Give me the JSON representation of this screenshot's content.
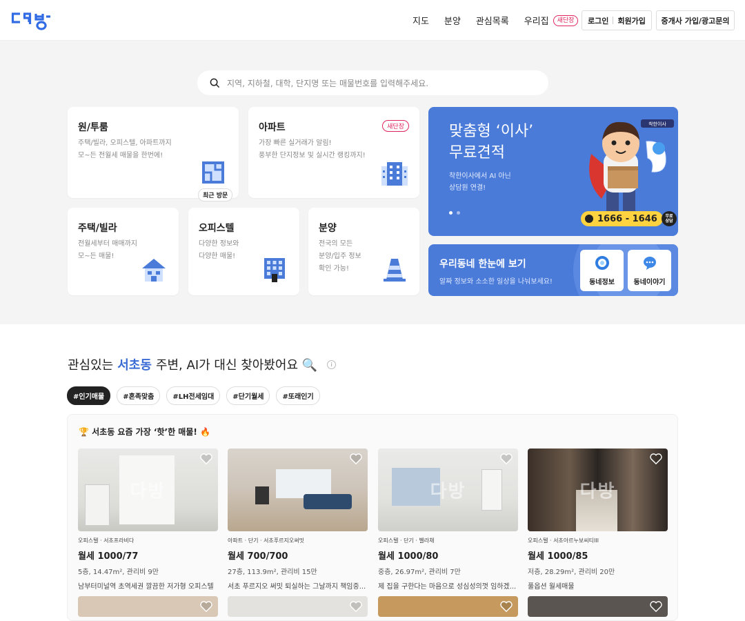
{
  "header": {
    "nav": [
      "지도",
      "분양",
      "관심목록",
      "우리집"
    ],
    "new_badge": "새단장",
    "login": "로그인",
    "signup": "회원가입",
    "agent": "중개사 가입/광고문의"
  },
  "search": {
    "placeholder": "지역, 지하철, 대학, 단지명 또는 매물번호를 입력해주세요."
  },
  "cards": [
    {
      "title": "원/투룸",
      "desc": "주택/빌라, 오피스텔, 아파트까지\n모~든 전월세 매물을 한번에!",
      "icon": "room-icon"
    },
    {
      "title": "아파트",
      "desc": "가장 빠른 실거래가 알림!\n풍부한 단지정보 및 실시간 랭킹까지!",
      "badge": "새단장",
      "icon": "apartment-icon"
    },
    {
      "title": "주택/빌라",
      "desc": "전월세부터 매매까지\n모~든 매물!",
      "icon": "house-icon"
    },
    {
      "title": "오피스텔",
      "desc": "다양한 정보와\n다양한 매물!",
      "icon": "officetel-icon"
    },
    {
      "title": "분양",
      "desc": "전국의 모든\n분양/입주 정보\n확인 가능!",
      "icon": "traffic-cone-icon"
    }
  ],
  "recent_visit": "최근 방문",
  "banner": {
    "title": "맞춤형 ‘이사’\n무료견적",
    "subtitle": "착한이사에서 AI 아닌\n상담원 연결!",
    "phone": "1666 - 1646",
    "consult": "무료\n상담",
    "brand": "착한이사"
  },
  "neighborhood": {
    "title": "우리동네 한눈에 보기",
    "subtitle": "알짜 정보와 소소한 일상을 나눠보세요!",
    "btn_info": "동네정보",
    "btn_talk": "동네이야기"
  },
  "section": {
    "title_pre": "관심있는",
    "title_place": "서초동",
    "title_post": "주변, AI가 대신 찾아봤어요 🔍",
    "info": "i",
    "chips": [
      "#인기매물",
      "#혼족맞춤",
      "#LH전세임대",
      "#단기월세",
      "#또래인기"
    ],
    "list_title": "🏆 서초동 요즘 가장 ‘핫’한 매물! 🔥"
  },
  "logo_text": "다방",
  "properties": [
    {
      "type": "오피스텔 · 서초프라비다",
      "price": "월세 1000/77",
      "spec": "5층, 14.47m², 관리비 9만",
      "desc": "남부터미널역 초역세권 깔끔한 저가형 오피스텔",
      "watermark": "다방"
    },
    {
      "type": "아파트 · 단기 · 서초푸르지오써밋",
      "price": "월세 700/700",
      "spec": "27층, 113.9m², 관리비 15만",
      "desc": "서초 푸르지오 써밋 퇴실하는 그날까지 책임중...",
      "watermark": ""
    },
    {
      "type": "오피스텔 · 단기 · 벨라채",
      "price": "월세 1000/80",
      "spec": "중층, 26.97m², 관리비 7만",
      "desc": "제 집을 구한다는 마음으로 성심성의껏 임하겠...",
      "watermark": "다방"
    },
    {
      "type": "오피스텔 · 서초아르누보씨티III",
      "price": "월세 1000/85",
      "spec": "저층, 28.29m², 관리비 20만",
      "desc": "풀옵션 월세매물",
      "watermark": "다방"
    }
  ],
  "colors": {
    "accent": "#4a7bd9",
    "brand": "#326ce5",
    "highlight": "#3a6bd4",
    "new": "#e0245e"
  }
}
